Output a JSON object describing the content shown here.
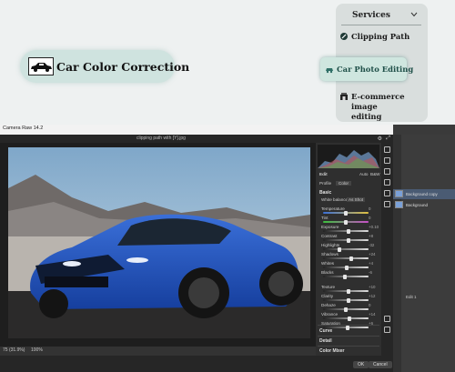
{
  "promo": {
    "title": "Car Color Correction",
    "icon": "car-icon"
  },
  "services": {
    "header": "Services",
    "items": [
      {
        "label": "Clipping Path",
        "icon": "pen-tool-icon"
      },
      {
        "label": "Car Photo Editing",
        "icon": "car-edit-icon",
        "active": true
      },
      {
        "label_line1": "E-commerce image",
        "label_line2": "editing",
        "icon": "store-icon"
      }
    ]
  },
  "editor": {
    "window_title": "Camera Raw 14.2",
    "doc_name": "clipping path with [Y].jpg",
    "zoom": "75 (31.9%)",
    "zoom_pct": "100%",
    "panel": {
      "tabs": [
        "Edit",
        "Auto",
        "B&W"
      ],
      "profile_label": "Profile",
      "profile_value": "Color",
      "basic_label": "Basic",
      "white_balance_label": "White balance",
      "white_balance_value": "As Shot",
      "sliders": [
        {
          "label": "Temperature",
          "value": "0",
          "pos": 0.5
        },
        {
          "label": "Tint",
          "value": "0",
          "pos": 0.5
        },
        {
          "label": "Exposure",
          "value": "+0.10",
          "pos": 0.55
        },
        {
          "label": "Contrast",
          "value": "+8",
          "pos": 0.55
        },
        {
          "label": "Highlights",
          "value": "-32",
          "pos": 0.35
        },
        {
          "label": "Shadows",
          "value": "+24",
          "pos": 0.62
        },
        {
          "label": "Whites",
          "value": "+4",
          "pos": 0.52
        },
        {
          "label": "Blacks",
          "value": "-6",
          "pos": 0.47
        },
        {
          "label": "Texture",
          "value": "+10",
          "pos": 0.55
        },
        {
          "label": "Clarity",
          "value": "+12",
          "pos": 0.56
        },
        {
          "label": "Dehaze",
          "value": "0",
          "pos": 0.5
        },
        {
          "label": "Vibrance",
          "value": "+14",
          "pos": 0.57
        },
        {
          "label": "Saturation",
          "value": "+6",
          "pos": 0.53
        }
      ],
      "sections": [
        "Curve",
        "Detail",
        "Color Mixer"
      ]
    },
    "buttons": {
      "ok": "OK",
      "cancel": "Cancel"
    },
    "layers": [
      {
        "name": "Background copy",
        "selected": true
      },
      {
        "name": "Background",
        "selected": false
      }
    ],
    "layer_extra": "Edit 1"
  }
}
